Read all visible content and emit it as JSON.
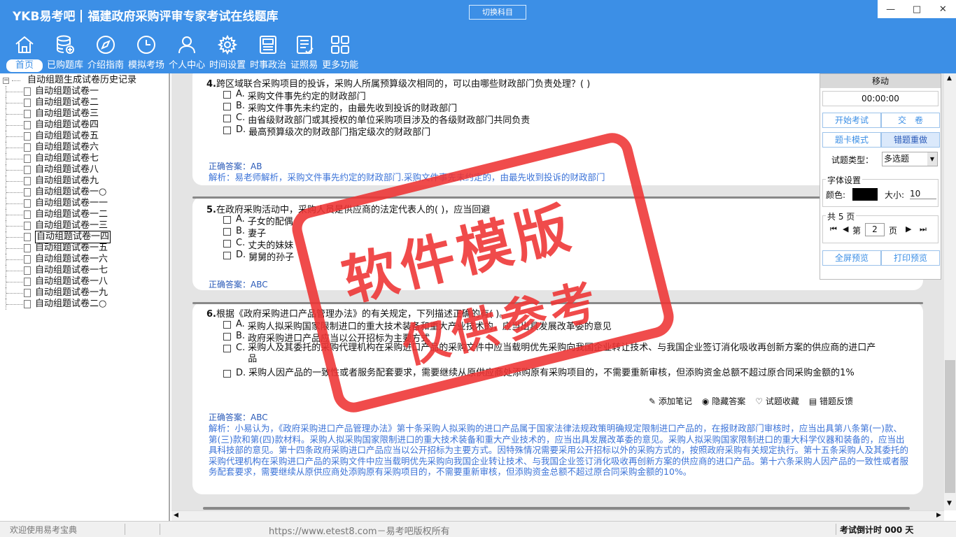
{
  "app": {
    "logo": "YKB易考吧",
    "title": "福建政府采购评审专家考试在线题库",
    "switch_label": "切换科目"
  },
  "colors": {
    "accent": "#3c8fe6",
    "stamp": "#e33333",
    "answer": "#2a5ab8"
  },
  "nav": [
    {
      "label": "首页",
      "icon": "home-icon",
      "active": true
    },
    {
      "label": "已购题库",
      "icon": "database-icon"
    },
    {
      "label": "介绍指南",
      "icon": "compass-icon"
    },
    {
      "label": "模拟考场",
      "icon": "clock-icon"
    },
    {
      "label": "个人中心",
      "icon": "user-icon"
    },
    {
      "label": "时间设置",
      "icon": "gear-icon"
    },
    {
      "label": "时事政治",
      "icon": "newspaper-icon"
    },
    {
      "label": "证照易",
      "icon": "checklist-icon"
    },
    {
      "label": "更多功能",
      "icon": "grid-icon"
    }
  ],
  "tree": {
    "root": "自动组题生成试卷历史记录",
    "items": [
      "自动组题试卷一",
      "自动组题试卷二",
      "自动组题试卷三",
      "自动组题试卷四",
      "自动组题试卷五",
      "自动组题试卷六",
      "自动组题试卷七",
      "自动组题试卷八",
      "自动组题试卷九",
      "自动组题试卷一○",
      "自动组题试卷一一",
      "自动组题试卷一二",
      "自动组题试卷一三",
      "自动组题试卷一四",
      "自动组题试卷一五",
      "自动组题试卷一六",
      "自动组题试卷一七",
      "自动组题试卷一八",
      "自动组题试卷一九",
      "自动组题试卷二○"
    ],
    "selected_index": 13
  },
  "actions": {
    "note": "添加笔记",
    "hide": "隐藏答案",
    "fav": "试题收藏",
    "feedback": "错题反馈",
    "feedback_short": "错"
  },
  "questions": [
    {
      "num": "4.",
      "text": "跨区域联合采购项目的投诉，采购人所属预算级次相同的，可以由哪些财政部门负责处理？( )",
      "options": [
        [
          "A.",
          "采购文件事先约定的财政部门"
        ],
        [
          "B.",
          "采购文件事先未约定的，由最先收到投诉的财政部门"
        ],
        [
          "C.",
          "由省级财政部门或其授权的单位采购项目涉及的各级财政部门共同负责"
        ],
        [
          "D.",
          "最高预算级次的财政部门指定级次的财政部门"
        ]
      ],
      "answer_label": "正确答案：",
      "answer": "AB",
      "analysis": "解析：易老师解析，采购文件事先约定的财政部门.采购文件事先未约定的，由最先收到投诉的财政部门"
    },
    {
      "num": "5.",
      "text": "在政府采购活动中，采购人员是供应商的法定代表人的(   )，应当回避",
      "options": [
        [
          "A.",
          "子女的配偶"
        ],
        [
          "B.",
          "妻子"
        ],
        [
          "C.",
          "丈夫的妹妹"
        ],
        [
          "D.",
          "舅舅的孙子"
        ]
      ],
      "answer_label": "正确答案：",
      "answer": "ABC"
    },
    {
      "num": "6.",
      "text": "根据《政府采购进口产品管理办法》的有关规定，下列描述正确的有(   )。",
      "options": [
        [
          "A.",
          "采购人拟采购国家限制进口的重大技术装备和重大产业技术的，应当出具发展改革委的意见"
        ],
        [
          "B.",
          "政府采购进口产品应当以公开招标为主要方式"
        ],
        [
          "C.",
          "采购人及其委托的采购代理机构在采购进口产品的采购文件中应当载明优先采购向我国企业转让技术、与我国企业签订消化吸收再创新方案的供应商的进口产品"
        ],
        [
          "D.",
          "采购人因产品的一致性或者服务配套要求，需要继续从原供应商处添购原有采购项目的，不需要重新审核，但添购资金总额不超过原合同采购金额的1%"
        ]
      ],
      "answer_label": "正确答案：",
      "answer": "ABC",
      "analysis": "解析：小易认为，《政府采购进口产品管理办法》第十条采购人拟采购的进口产品属于国家法律法规政策明确规定限制进口产品的，在报财政部门审核时，应当出具第八条第(一)款、第(三)款和第(四)款材料。采购人拟采购国家限制进口的重大技术装备和重大产业技术的，应当出具发展改革委的意见。采购人拟采购国家限制进口的重大科学仪器和装备的，应当出具科技部的意见。第十四条政府采购进口产品应当以公开招标为主要方式。因特殊情况需要采用公开招标以外的采购方式的，按照政府采购有关规定执行。第十五条采购人及其委托的采购代理机构在采购进口产品的采购文件中应当载明优先采购向我国企业转让技术、与我国企业签订消化吸收再创新方案的供应商的进口产品。第十六条采购人因产品的一致性或者服务配套要求，需要继续从原供应商处添购原有采购项目的，不需要重新审核，但添购资金总额不超过原合同采购金额的10%。"
    }
  ],
  "panel": {
    "title": "移动",
    "timer": "00:00:00",
    "start": "开始考试",
    "submit": "交　卷",
    "card_mode": "题卡模式",
    "redo": "错题重做",
    "type_label": "试题类型：",
    "type_value": "多选题",
    "font_group": "字体设置",
    "color_label": "颜色:",
    "size_label": "大小:",
    "size_value": "10",
    "pages_group": "共 5 页",
    "page_prefix": "第",
    "page_value": "2",
    "page_suffix": "页",
    "fullscreen": "全屏预览",
    "print": "打印预览"
  },
  "status": {
    "welcome": "欢迎使用易考宝典",
    "url": "https://www.etest8.com－易考吧版权所有",
    "countdown": "考试倒计时 000 天"
  },
  "stamp": {
    "line1": "软件模版",
    "line2": "仅供参考"
  }
}
